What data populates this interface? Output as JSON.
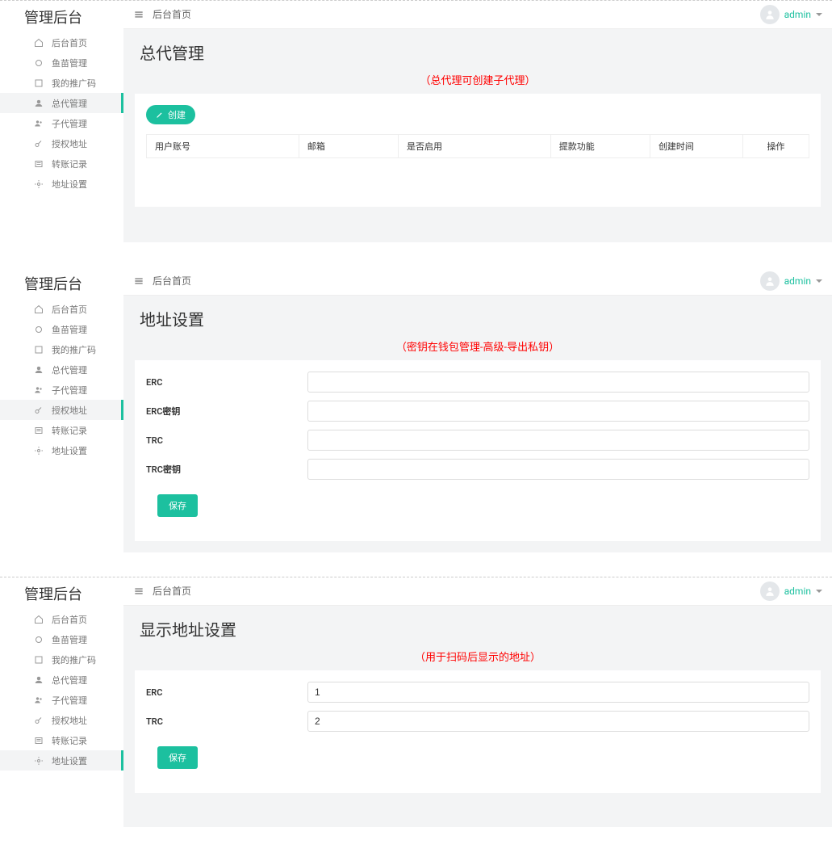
{
  "shared": {
    "brand": "管理后台",
    "breadcrumb": "后台首页",
    "user": "admin",
    "nav": {
      "home": "后台首页",
      "fish": "鱼苗管理",
      "promo": "我的推广码",
      "agent": "总代管理",
      "subagent": "子代管理",
      "auth_addr": "授权地址",
      "transfer": "转账记录",
      "addr_set": "地址设置"
    }
  },
  "p1": {
    "title": "总代管理",
    "note": "（总代理可创建子代理）",
    "create": "创建",
    "cols": {
      "user": "用户账号",
      "email": "邮箱",
      "enabled": "是否启用",
      "withdraw": "提款功能",
      "created": "创建时间",
      "ops": "操作"
    }
  },
  "p2": {
    "title": "地址设置",
    "note": "（密钥在钱包管理-高级-导出私钥）",
    "erc": "ERC",
    "erc_key": "ERC密钥",
    "trc": "TRC",
    "trc_key": "TRC密钥",
    "save": "保存"
  },
  "p3": {
    "title": "显示地址设置",
    "note": "（用于扫码后显示的地址）",
    "erc": "ERC",
    "trc": "TRC",
    "erc_val": "1",
    "trc_val": "2",
    "save": "保存"
  }
}
